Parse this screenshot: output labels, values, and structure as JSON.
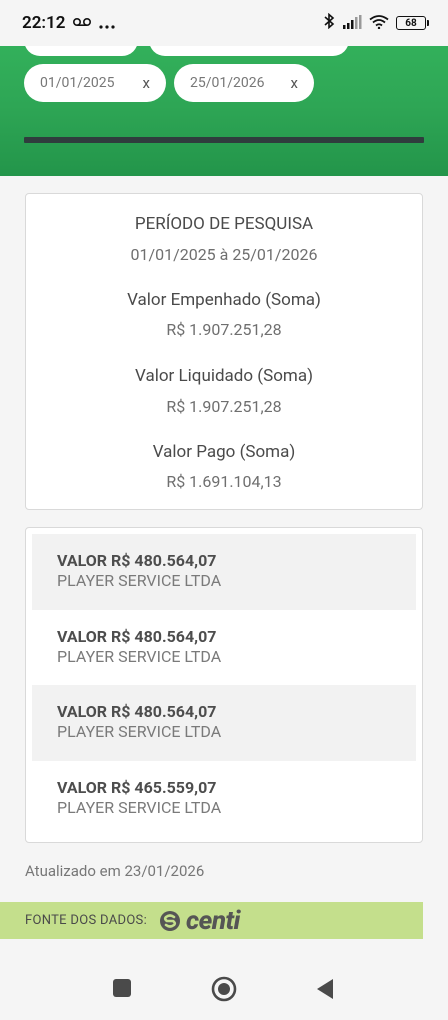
{
  "status_bar": {
    "time": "22:12",
    "battery": "68"
  },
  "filters": {
    "start_date": "01/01/2025",
    "end_date": "25/01/2026",
    "clear_label": "x"
  },
  "summary": {
    "period_label": "PERÍODO DE PESQUISA",
    "period_value": "01/01/2025 à 25/01/2026",
    "empenhado_label": "Valor Empenhado (Soma)",
    "empenhado_value": "R$ 1.907.251,28",
    "liquidado_label": "Valor Liquidado (Soma)",
    "liquidado_value": "R$ 1.907.251,28",
    "pago_label": "Valor Pago (Soma)",
    "pago_value": "R$ 1.691.104,13"
  },
  "payments": [
    {
      "amount": "VALOR R$ 480.564,07",
      "company": "PLAYER SERVICE LTDA"
    },
    {
      "amount": "VALOR R$ 480.564,07",
      "company": "PLAYER SERVICE LTDA"
    },
    {
      "amount": "VALOR R$ 480.564,07",
      "company": "PLAYER SERVICE LTDA"
    },
    {
      "amount": "VALOR R$ 465.559,07",
      "company": "PLAYER SERVICE LTDA"
    }
  ],
  "footer": {
    "updated_text": "Atualizado em 23/01/2026",
    "source_label": "FONTE DOS DADOS:",
    "logo_text": "centi"
  },
  "colors": {
    "header_green": "#2ea655",
    "source_bar": "#c4df8c"
  },
  "icons": [
    "voicemail-icon",
    "more-dots-icon",
    "bluetooth-icon",
    "signal-icon",
    "wifi-icon",
    "battery-icon",
    "centi-logo-icon",
    "recents-icon",
    "home-icon",
    "back-icon"
  ]
}
